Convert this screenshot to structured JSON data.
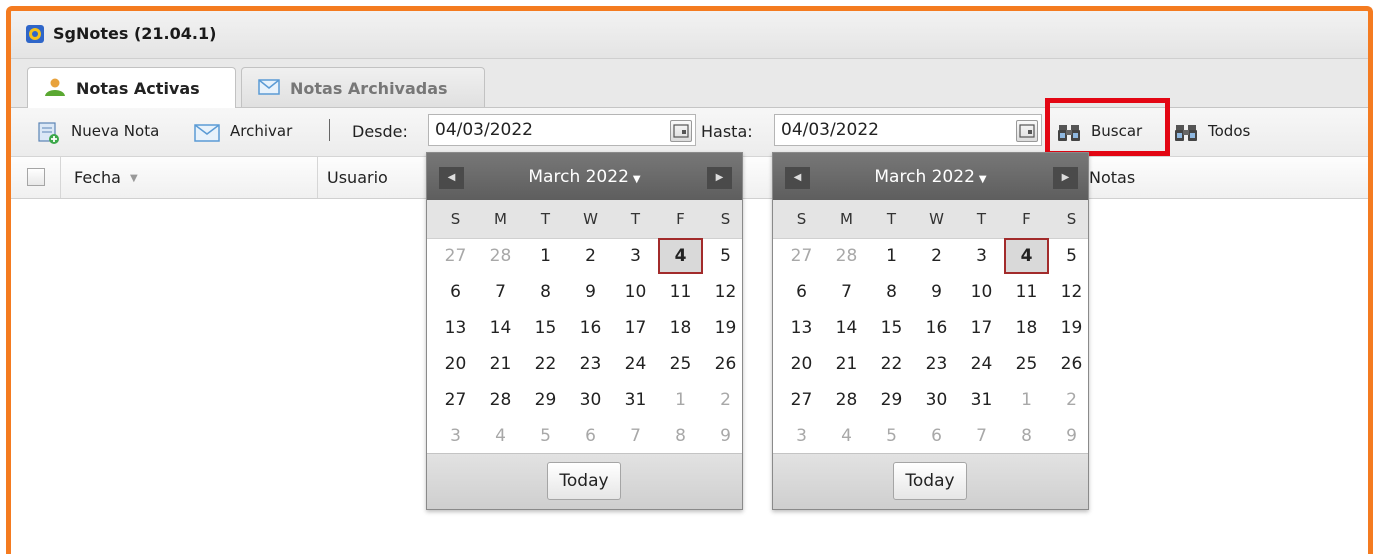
{
  "app": {
    "title": "SgNotes (21.04.1)"
  },
  "tabs": [
    {
      "label": "Notas Activas",
      "active": true
    },
    {
      "label": "Notas Archivadas",
      "active": false
    }
  ],
  "toolbar": {
    "new_note": "Nueva Nota",
    "archive": "Archivar",
    "sep": "|",
    "from_label": "Desde:",
    "from_value": "04/03/2022",
    "to_label": "Hasta:",
    "to_value": "04/03/2022",
    "search": "Buscar",
    "all": "Todos"
  },
  "grid": {
    "columns": [
      "Fecha",
      "Usuario",
      "Notas"
    ],
    "sort_indicator": "▼"
  },
  "calendar": {
    "month_label": "March 2022",
    "dropdown": "▼",
    "prev": "◀",
    "next": "▶",
    "weekdays": [
      "S",
      "M",
      "T",
      "W",
      "T",
      "F",
      "S"
    ],
    "days": [
      {
        "d": "27",
        "o": true
      },
      {
        "d": "28",
        "o": true
      },
      {
        "d": "1"
      },
      {
        "d": "2"
      },
      {
        "d": "3"
      },
      {
        "d": "4",
        "s": true
      },
      {
        "d": "5"
      },
      {
        "d": "6"
      },
      {
        "d": "7"
      },
      {
        "d": "8"
      },
      {
        "d": "9"
      },
      {
        "d": "10"
      },
      {
        "d": "11"
      },
      {
        "d": "12"
      },
      {
        "d": "13"
      },
      {
        "d": "14"
      },
      {
        "d": "15"
      },
      {
        "d": "16"
      },
      {
        "d": "17"
      },
      {
        "d": "18"
      },
      {
        "d": "19"
      },
      {
        "d": "20"
      },
      {
        "d": "21"
      },
      {
        "d": "22"
      },
      {
        "d": "23"
      },
      {
        "d": "24"
      },
      {
        "d": "25"
      },
      {
        "d": "26"
      },
      {
        "d": "27"
      },
      {
        "d": "28"
      },
      {
        "d": "29"
      },
      {
        "d": "30"
      },
      {
        "d": "31"
      },
      {
        "d": "1",
        "o": true
      },
      {
        "d": "2",
        "o": true
      },
      {
        "d": "3",
        "o": true
      },
      {
        "d": "4",
        "o": true
      },
      {
        "d": "5",
        "o": true
      },
      {
        "d": "6",
        "o": true
      },
      {
        "d": "7",
        "o": true
      },
      {
        "d": "8",
        "o": true
      },
      {
        "d": "9",
        "o": true
      }
    ],
    "today_label": "Today"
  },
  "colors": {
    "frame": "#f47b20",
    "highlight": "#e30613",
    "selected_border": "#a22b2b"
  }
}
